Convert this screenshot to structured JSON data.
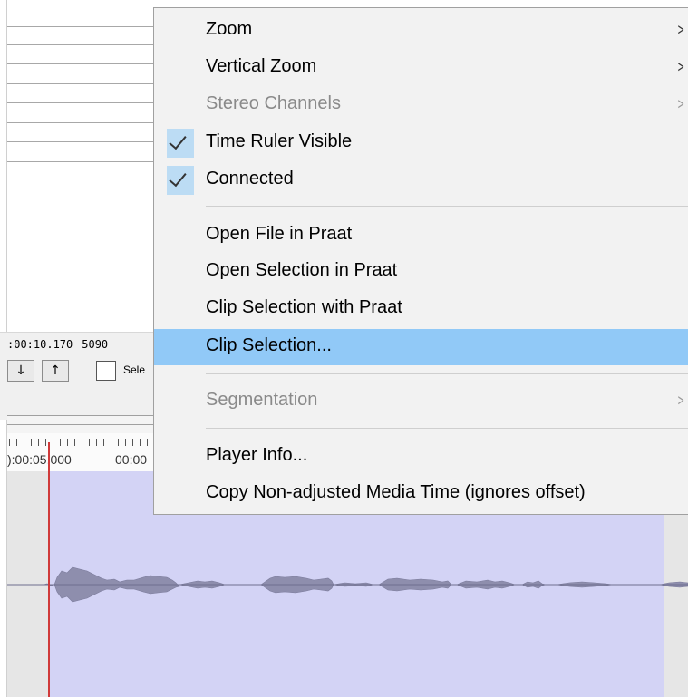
{
  "background": {
    "time_readout": {
      "time": ":00:10.170",
      "samples": "5090"
    },
    "nav_buttons": [
      "↓",
      "↑"
    ],
    "selection_checkbox_label": "Sele",
    "ruler": {
      "label_1": "):00:05.000",
      "label_2": "00:00"
    }
  },
  "colors": {
    "menu_highlight": "#91c9f7",
    "selection_region": "#d3d3f5",
    "waveform": "#8e8ead",
    "cursor": "#d03a3a"
  },
  "context_menu": {
    "items": [
      {
        "label": "Zoom",
        "submenu": true,
        "disabled": false,
        "checked": false
      },
      {
        "label": "Vertical Zoom",
        "submenu": true,
        "disabled": false,
        "checked": false
      },
      {
        "label": "Stereo Channels",
        "submenu": true,
        "disabled": true,
        "checked": false
      },
      {
        "label": "Time Ruler Visible",
        "submenu": false,
        "disabled": false,
        "checked": true
      },
      {
        "label": "Connected",
        "submenu": false,
        "disabled": false,
        "checked": true
      },
      {
        "label": "Open File in Praat",
        "submenu": false,
        "disabled": false,
        "checked": false
      },
      {
        "label": "Open Selection in Praat",
        "submenu": false,
        "disabled": false,
        "checked": false
      },
      {
        "label": "Clip Selection with Praat",
        "submenu": false,
        "disabled": false,
        "checked": false
      },
      {
        "label": "Clip Selection...",
        "submenu": false,
        "disabled": false,
        "checked": false,
        "highlighted": true
      },
      {
        "label": "Segmentation",
        "submenu": true,
        "disabled": true,
        "checked": false
      },
      {
        "label": "Player Info...",
        "submenu": false,
        "disabled": false,
        "checked": false
      },
      {
        "label": "Copy Non-adjusted Media Time (ignores offset)",
        "submenu": false,
        "disabled": false,
        "checked": false
      }
    ],
    "submenu_arrow": ">",
    "check_icon": "checkmark-icon"
  }
}
